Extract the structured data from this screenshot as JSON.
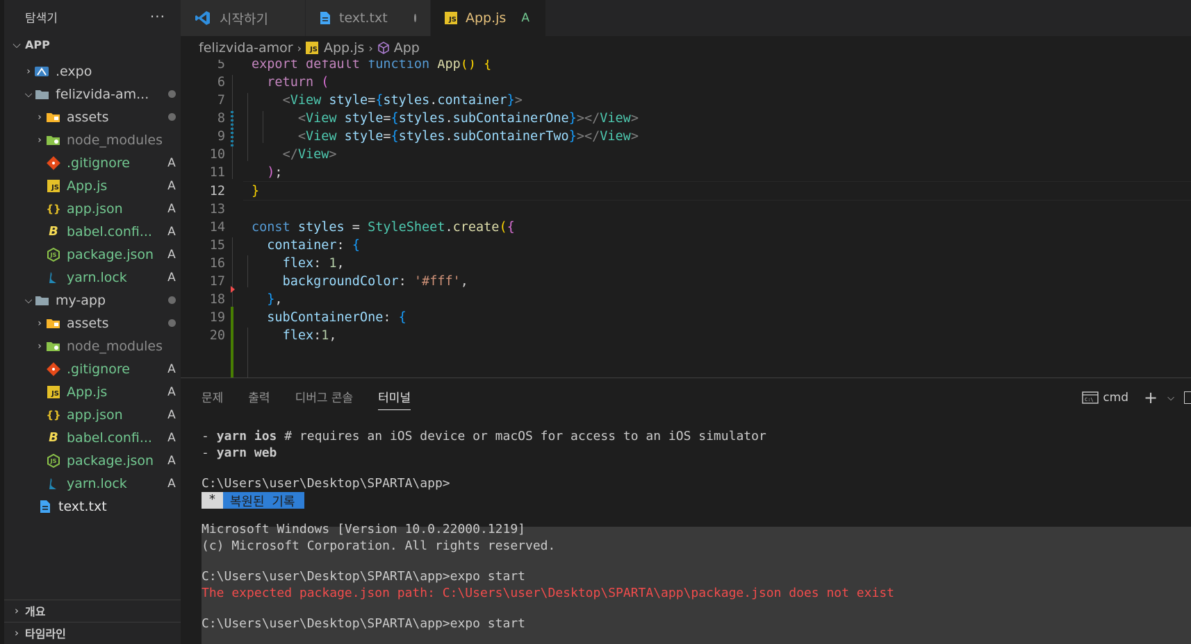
{
  "colors": {
    "accent_yellow": "#e5c07b",
    "git_added": "#73c991",
    "error_red": "#f14c4c",
    "restored_blue": "#2e7ed6"
  },
  "sidebar": {
    "title": "탐색기",
    "more_icon": "ellipsis-icon",
    "section_title": "APP",
    "items": [
      {
        "label": ".expo",
        "icon": "expo-folder-icon",
        "badge": ""
      },
      {
        "label": "felizvida-am...",
        "icon": "folder-open-icon",
        "badge": ""
      },
      {
        "label": "assets",
        "icon": "folder-assets-icon",
        "badge": ""
      },
      {
        "label": "node_modules",
        "icon": "folder-node-icon",
        "badge": ""
      },
      {
        "label": ".gitignore",
        "icon": "git-icon",
        "badge": "A"
      },
      {
        "label": "App.js",
        "icon": "js-icon",
        "badge": "A"
      },
      {
        "label": "app.json",
        "icon": "json-icon",
        "badge": "A"
      },
      {
        "label": "babel.confi...",
        "icon": "babel-icon",
        "badge": "A"
      },
      {
        "label": "package.json",
        "icon": "npm-icon",
        "badge": "A"
      },
      {
        "label": "yarn.lock",
        "icon": "yarn-icon",
        "badge": "A"
      },
      {
        "label": "my-app",
        "icon": "folder-open-icon",
        "badge": ""
      },
      {
        "label": "assets",
        "icon": "folder-assets-icon",
        "badge": ""
      },
      {
        "label": "node_modules",
        "icon": "folder-node-icon",
        "badge": ""
      },
      {
        "label": ".gitignore",
        "icon": "git-icon",
        "badge": "A"
      },
      {
        "label": "App.js",
        "icon": "js-icon",
        "badge": "A"
      },
      {
        "label": "app.json",
        "icon": "json-icon",
        "badge": "A"
      },
      {
        "label": "babel.confi...",
        "icon": "babel-icon",
        "badge": "A"
      },
      {
        "label": "package.json",
        "icon": "npm-icon",
        "badge": "A"
      },
      {
        "label": "yarn.lock",
        "icon": "yarn-icon",
        "badge": "A"
      },
      {
        "label": "text.txt",
        "icon": "file-text-icon",
        "badge": ""
      }
    ],
    "outline_title": "개요",
    "timeline_title": "타임라인"
  },
  "tabs": [
    {
      "label": "시작하기",
      "icon": "vscode-icon"
    },
    {
      "label": "text.txt",
      "icon": "file-text-icon"
    },
    {
      "label": "App.js",
      "icon": "js-icon",
      "status": "A"
    }
  ],
  "breadcrumb": {
    "folder": "felizvida-amor",
    "file": "App.js",
    "symbol": "App"
  },
  "editor": {
    "line_numbers": [
      "5",
      "6",
      "7",
      "8",
      "9",
      "10",
      "11",
      "12",
      "13",
      "14",
      "15",
      "16",
      "17",
      "18",
      "19",
      "20"
    ],
    "current_line": "12"
  },
  "panel": {
    "tabs": [
      "문제",
      "출력",
      "디버그 콘솔",
      "터미널"
    ],
    "shell_label": "cmd",
    "terminal": {
      "line1_cmd": "yarn ios",
      "line1_rest": " # requires an iOS device or macOS for access to an iOS simulator",
      "line2_cmd": "yarn web",
      "prompt1": "C:\\Users\\user\\Desktop\\SPARTA\\app>",
      "restored_star": "*",
      "restored_text": "복원된 기록",
      "win_version": "Microsoft Windows [Version 10.0.22000.1219]",
      "win_copyright": "(c) Microsoft Corporation. All rights reserved.",
      "prompt2": "C:\\Users\\user\\Desktop\\SPARTA\\app>expo start",
      "error": "The expected package.json path: C:\\Users\\user\\Desktop\\SPARTA\\app\\package.json does not exist",
      "prompt3": "C:\\Users\\user\\Desktop\\SPARTA\\app>expo start"
    }
  }
}
